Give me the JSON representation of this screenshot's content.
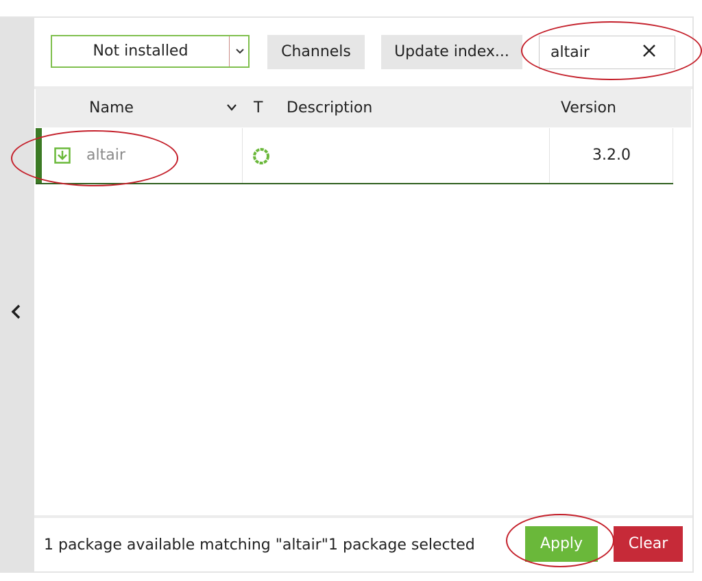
{
  "toolbar": {
    "filter_value": "Not installed",
    "channels_label": "Channels",
    "update_index_label": "Update index...",
    "search_value": "altair",
    "clear_search_icon": "close-icon"
  },
  "table": {
    "columns": [
      "Name",
      "T",
      "Description",
      "Version"
    ],
    "rows": [
      {
        "name": "altair",
        "description": "",
        "version": "3.2.0",
        "status_icon": "download-icon",
        "type_icon": "conda-ring-icon"
      }
    ]
  },
  "footer": {
    "match_text": "1 package available matching \"altair\"",
    "selected_text": "1 package selected",
    "apply_label": "Apply",
    "clear_label": "Clear"
  },
  "colors": {
    "accent_green": "#6ab83a",
    "danger_red": "#c62a38",
    "selection_green": "#3b7a24",
    "annotation_red": "#c41f2a"
  }
}
